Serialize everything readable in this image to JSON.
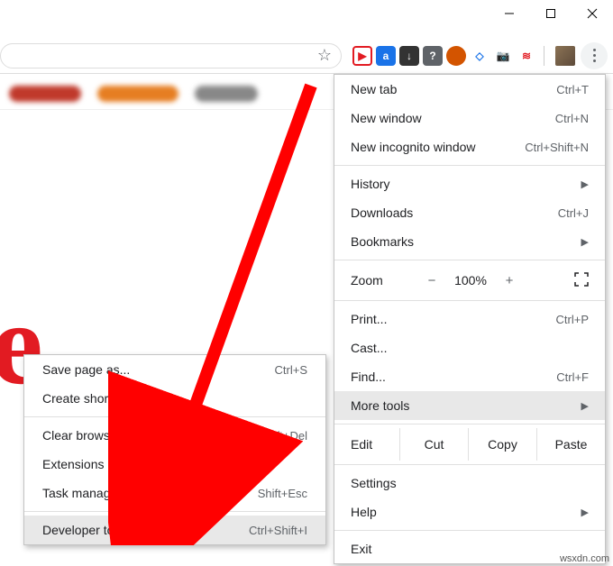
{
  "window_controls": {
    "minimize": "minimize",
    "maximize": "maximize",
    "close": "close"
  },
  "toolbar": {
    "star": "☆",
    "extensions": [
      {
        "name": "ext-red-play",
        "glyph": "▶",
        "bg": "#fff",
        "color": "#e21b22",
        "border": "2px solid #e21b22"
      },
      {
        "name": "ext-blue-a",
        "glyph": "a",
        "bg": "#1a73e8",
        "color": "#fff"
      },
      {
        "name": "ext-png-download",
        "glyph": "↓",
        "bg": "#333",
        "color": "#fff",
        "small": "png"
      },
      {
        "name": "ext-question",
        "glyph": "?",
        "bg": "#5f6368",
        "color": "#fff"
      },
      {
        "name": "ext-avatar-circle",
        "glyph": "",
        "bg": "#d35400",
        "color": "#fff",
        "round": true
      },
      {
        "name": "ext-tag",
        "glyph": "◇",
        "bg": "#fff",
        "color": "#1a73e8"
      },
      {
        "name": "ext-camera",
        "glyph": "📷",
        "bg": "#fff",
        "color": "#5f6368"
      },
      {
        "name": "ext-whirl",
        "glyph": "≋",
        "bg": "#fff",
        "color": "#e21b22"
      }
    ]
  },
  "menu": {
    "new_tab": {
      "label": "New tab",
      "shortcut": "Ctrl+T"
    },
    "new_window": {
      "label": "New window",
      "shortcut": "Ctrl+N"
    },
    "new_incognito": {
      "label": "New incognito window",
      "shortcut": "Ctrl+Shift+N"
    },
    "history": {
      "label": "History"
    },
    "downloads": {
      "label": "Downloads",
      "shortcut": "Ctrl+J"
    },
    "bookmarks": {
      "label": "Bookmarks"
    },
    "zoom": {
      "label": "Zoom",
      "minus": "−",
      "value": "100%",
      "plus": "+"
    },
    "print": {
      "label": "Print...",
      "shortcut": "Ctrl+P"
    },
    "cast": {
      "label": "Cast..."
    },
    "find": {
      "label": "Find...",
      "shortcut": "Ctrl+F"
    },
    "more_tools": {
      "label": "More tools"
    },
    "edit": {
      "label": "Edit",
      "cut": "Cut",
      "copy": "Copy",
      "paste": "Paste"
    },
    "settings": {
      "label": "Settings"
    },
    "help": {
      "label": "Help"
    },
    "exit": {
      "label": "Exit"
    }
  },
  "submenu": {
    "save_page": {
      "label": "Save page as...",
      "shortcut": "Ctrl+S"
    },
    "create_shortcut": {
      "label": "Create shortcut..."
    },
    "clear_browsing": {
      "label": "Clear browsing data...",
      "shortcut": "Ctrl+Shift+Del"
    },
    "extensions": {
      "label": "Extensions"
    },
    "task_manager": {
      "label": "Task manager",
      "shortcut": "Shift+Esc"
    },
    "developer_tools": {
      "label": "Developer tools",
      "shortcut": "Ctrl+Shift+I"
    }
  },
  "watermark": "wsxdn.com"
}
